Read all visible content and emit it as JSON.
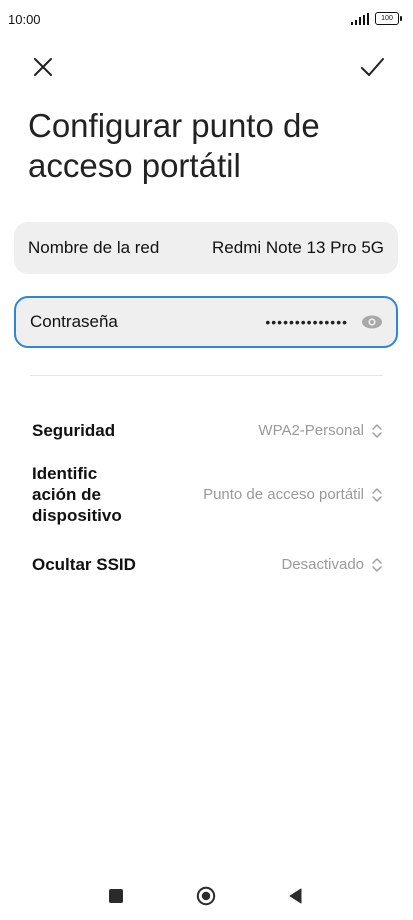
{
  "status_bar": {
    "time": "10:00",
    "battery": "100"
  },
  "toolbar": {
    "close_icon": "close-icon",
    "confirm_icon": "check-icon"
  },
  "page": {
    "title": "Configurar punto de acceso portátil"
  },
  "network": {
    "name_label": "Nombre de la red",
    "name_value": "Redmi Note 13 Pro 5G",
    "password_label": "Contraseña",
    "password_value": "••••••••••••••",
    "visibility_icon": "eye-icon"
  },
  "settings": {
    "security_label": "Seguridad",
    "security_value": "WPA2-Personal",
    "device_id_label": "Identific ación de dispositivo",
    "device_id_value": "Punto de acceso portátil",
    "hide_ssid_label": "Ocultar SSID",
    "hide_ssid_value": "Desactivado"
  },
  "colors": {
    "accent": "#2e86d6",
    "field_bg": "#efefef",
    "secondary_text": "#9a9a9a"
  }
}
